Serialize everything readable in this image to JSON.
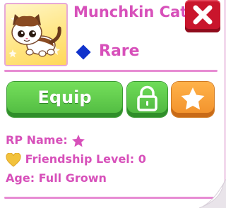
{
  "pet": {
    "name": "Munchkin Cat",
    "rarity": "Rare"
  },
  "actions": {
    "equip_label": "Equip"
  },
  "info": {
    "rp_name_label": "RP Name:",
    "friendship_label": "Friendship Level:",
    "friendship_value": "0",
    "age_label": "Age:",
    "age_value": "Full Grown"
  },
  "icons": {
    "close": "close-x-icon",
    "rarity": "diamond-icon",
    "lock": "padlock-icon",
    "favorite": "star-icon",
    "rp_name": "star-icon",
    "friendship": "heart-icon"
  },
  "colors": {
    "title_pink": "#d750ba",
    "divider_pink": "#e78bd3",
    "close_red": "#c9152c",
    "equip_green": "#4fb940",
    "favorite_orange": "#f1902a",
    "rarity_blue": "#1133cc",
    "heart_gold": "#f2c23c"
  }
}
